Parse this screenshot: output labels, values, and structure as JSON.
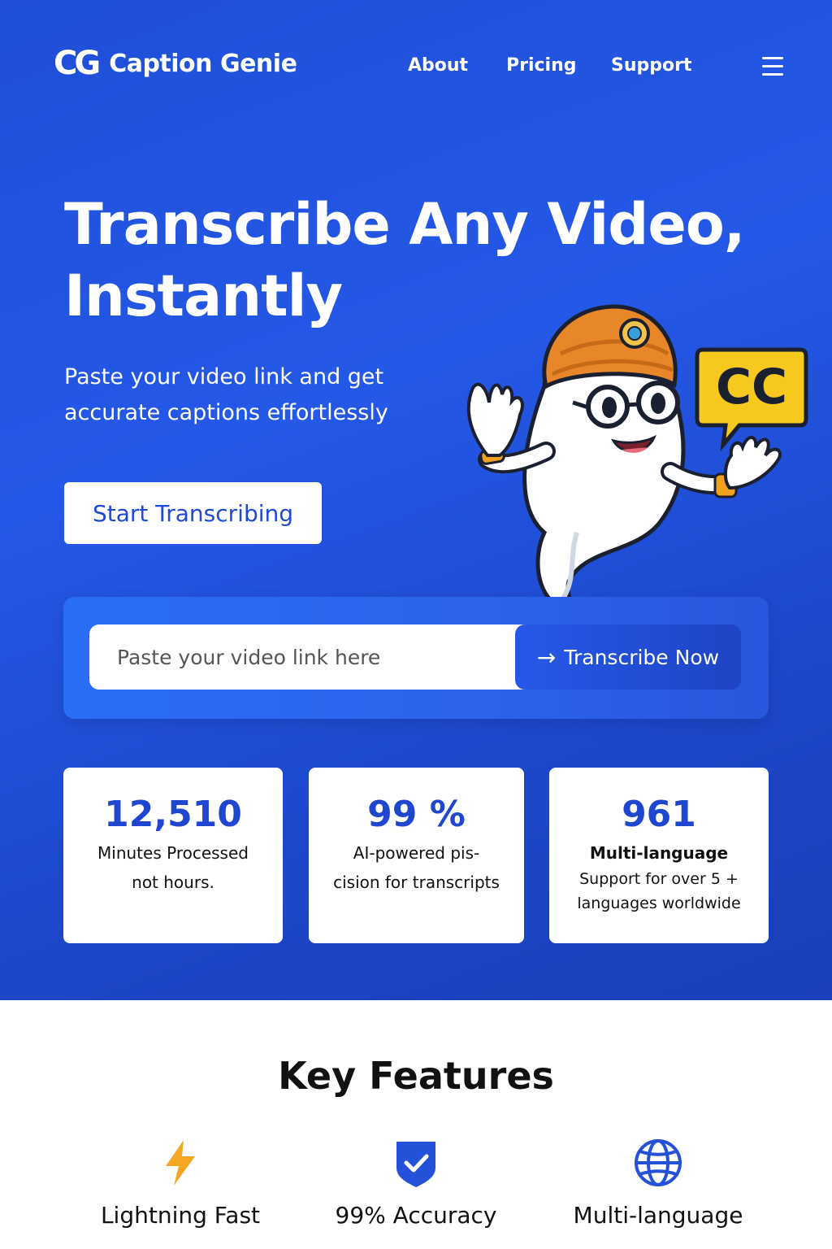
{
  "brand": {
    "logo_mark": "CG",
    "name": "Caption Genie"
  },
  "nav": {
    "about": "About",
    "pricing": "Pricing",
    "support": "Support"
  },
  "hero": {
    "headline_line1": "Transcribe Any Video,",
    "headline_line2": "Instantly",
    "subhead": "Paste your video link and get accurate captions effortlessly",
    "cta_label": "Start Transcribing"
  },
  "mascot": {
    "badge_text": "CC"
  },
  "transcribe_form": {
    "placeholder": "Paste your video link here",
    "value": "",
    "button_label": "Transcribe Now"
  },
  "stats": [
    {
      "value": "12,510",
      "line1": "Minutes Processed",
      "line2": "not hours."
    },
    {
      "value": "99 %",
      "line1": "AI-powered pis-",
      "line2": "cision for transcripts"
    },
    {
      "value": "961",
      "line1": "Multi-language",
      "line2": "Support for over 5 +",
      "line3": "languages worldwide"
    }
  ],
  "features": {
    "title": "Key Features",
    "items": [
      {
        "label": "Lightning Fast",
        "icon": "lightning-icon"
      },
      {
        "label": "99% Accuracy",
        "icon": "shield-check-icon"
      },
      {
        "label": "Multi-language",
        "icon": "globe-icon"
      }
    ]
  },
  "colors": {
    "hero_bg": "#2458e6",
    "accent_blue": "#1f46cf",
    "lightning": "#f5a623",
    "mascot_turban": "#e8862a",
    "cc_badge": "#f7c81e"
  }
}
